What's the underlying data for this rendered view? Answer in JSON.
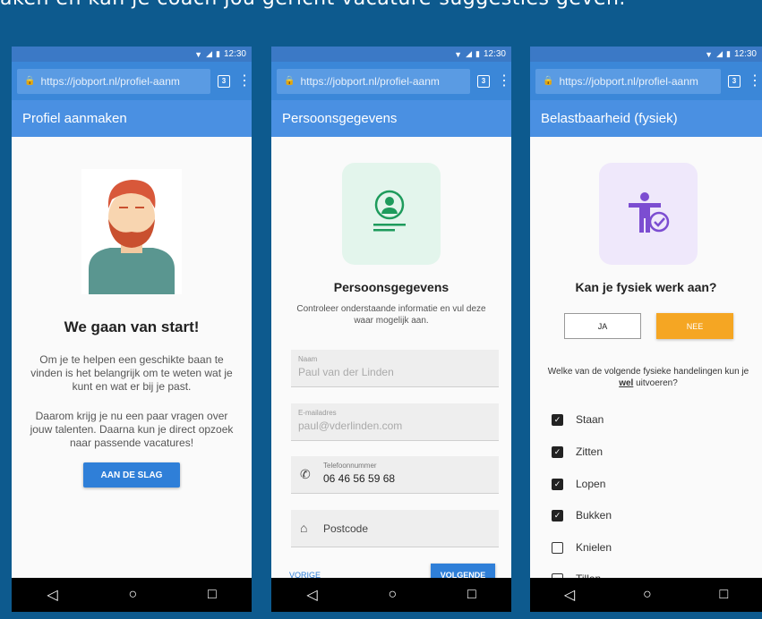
{
  "page": {
    "header_text": "aken en kan je coach jou gericht vacature-suggesties geven."
  },
  "status": {
    "time": "12:30"
  },
  "screens": [
    {
      "url": "https://jobport.nl/profiel-aanm",
      "tab_count": "3",
      "appbar_title": "Profiel aanmaken",
      "heading": "We gaan van start!",
      "paragraph1": "Om je te helpen een geschikte baan te vinden is het belangrijk om te weten wat je kunt en wat er bij je past.",
      "paragraph2": "Daarom krijg je nu een paar vragen over jouw talenten. Daarna kun je direct opzoek naar passende vacatures!",
      "cta_label": "AAN DE SLAG"
    },
    {
      "url": "https://jobport.nl/profiel-aanm",
      "tab_count": "3",
      "appbar_title": "Persoonsgegevens",
      "heading": "Persoonsgegevens",
      "subtitle": "Controleer onderstaande informatie en vul deze waar mogelijk aan.",
      "fields": [
        {
          "label": "Naam",
          "value": "Paul van der Linden"
        },
        {
          "label": "E-mailadres",
          "value": "paul@vderlinden.com"
        },
        {
          "label": "Telefoonnummer",
          "value": "06 46 56 59 68"
        },
        {
          "label": "",
          "value": "Postcode"
        }
      ],
      "prev_label": "VORIGE",
      "next_label": "VOLGENDE"
    },
    {
      "url": "https://jobport.nl/profiel-aanm",
      "tab_count": "3",
      "appbar_title": "Belastbaarheid (fysiek)",
      "heading": "Kan je fysiek werk aan?",
      "yes_label": "JA",
      "no_label": "NEE",
      "question_prefix": "Welke van de volgende fysieke handelingen kun je ",
      "question_emph": "wel",
      "question_suffix": " uitvoeren?",
      "items": [
        {
          "label": "Staan",
          "checked": true
        },
        {
          "label": "Zitten",
          "checked": true
        },
        {
          "label": "Lopen",
          "checked": true
        },
        {
          "label": "Bukken",
          "checked": true
        },
        {
          "label": "Knielen",
          "checked": false
        },
        {
          "label": "Tillen",
          "checked": false
        }
      ]
    }
  ],
  "colors": {
    "appbar": "#4a90e2",
    "urlbar": "#3b87d8",
    "accent_orange": "#f5a623",
    "button_blue": "#2f7fd8",
    "background": "#0d5a8e"
  },
  "icons": {
    "nav_back": "◁",
    "nav_home": "○",
    "nav_recent": "□"
  }
}
